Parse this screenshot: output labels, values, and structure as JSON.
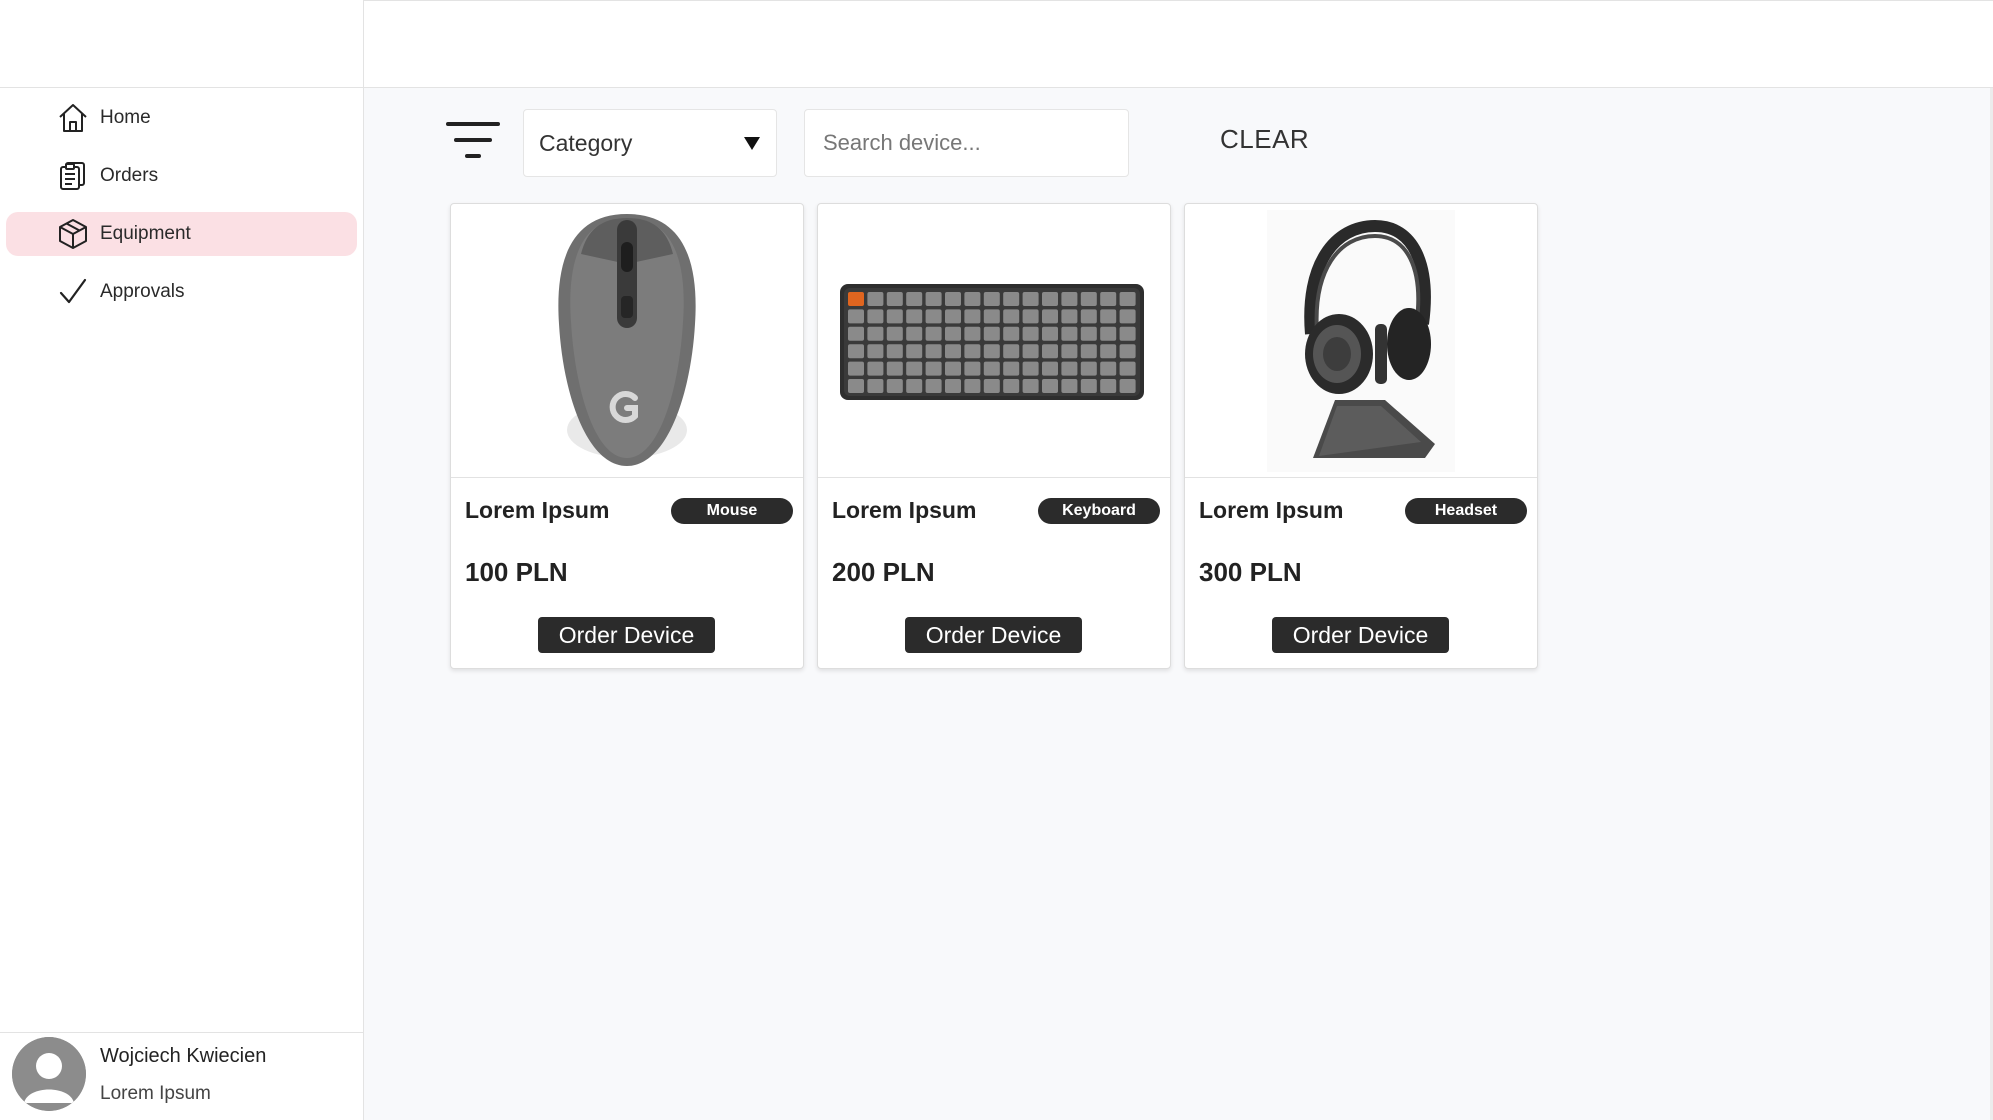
{
  "sidebar": {
    "items": [
      {
        "label": "Home",
        "icon": "home-icon",
        "active": false
      },
      {
        "label": "Orders",
        "icon": "clipboard-icon",
        "active": false
      },
      {
        "label": "Equipment",
        "icon": "box-icon",
        "active": true
      },
      {
        "label": "Approvals",
        "icon": "checkmark-icon",
        "active": false
      }
    ]
  },
  "user": {
    "name": "Wojciech Kwiecien",
    "role": "Lorem Ipsum"
  },
  "filters": {
    "category_value": "Category",
    "search_placeholder": "Search device...",
    "clear_label": "CLEAR"
  },
  "products": [
    {
      "name": "Lorem Ipsum",
      "category": "Mouse",
      "price": "100 PLN",
      "button": "Order Device",
      "image": "mouse-image"
    },
    {
      "name": "Lorem Ipsum",
      "category": "Keyboard",
      "price": "200 PLN",
      "button": "Order Device",
      "image": "keyboard-image"
    },
    {
      "name": "Lorem Ipsum",
      "category": "Headset",
      "price": "300 PLN",
      "button": "Order Device",
      "image": "headset-image"
    }
  ],
  "colors": {
    "active_nav_bg": "#fbe0e4",
    "button_bg": "#2b2b2b",
    "page_bg": "#f8f9fb"
  }
}
